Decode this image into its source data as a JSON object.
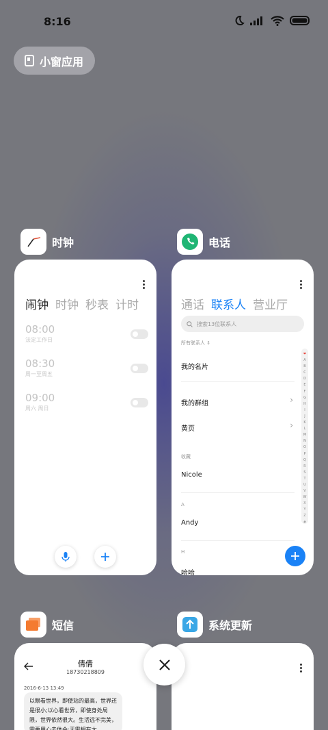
{
  "status": {
    "time": "8:16"
  },
  "float_window": {
    "label": "小窗应用"
  },
  "apps": {
    "clock": {
      "name": "时钟",
      "tabs": [
        "闹钟",
        "时钟",
        "秒表",
        "计时"
      ],
      "alarms": [
        {
          "time": "08:00",
          "sub": "法定工作日"
        },
        {
          "time": "08:30",
          "sub": "周一至周五"
        },
        {
          "time": "09:00",
          "sub": "周六 周日"
        }
      ]
    },
    "phone": {
      "name": "电话",
      "tabs": [
        "通话",
        "联系人",
        "营业厅"
      ],
      "search_placeholder": "搜索13位联系人",
      "all_contacts": "所有联系人",
      "my_card": "我的名片",
      "my_groups": "我的群组",
      "yellow_pages": "黄页",
      "favorites_label": "收藏",
      "section_a": "A",
      "section_h": "H",
      "contacts": [
        "Nicole",
        "Andy",
        "哈哈"
      ],
      "alphabet": [
        "❤",
        "A",
        "B",
        "C",
        "D",
        "E",
        "F",
        "G",
        "H",
        "I",
        "J",
        "K",
        "L",
        "M",
        "N",
        "O",
        "P",
        "Q",
        "R",
        "S",
        "T",
        "U",
        "V",
        "W",
        "X",
        "Y",
        "Z",
        "#"
      ]
    },
    "sms": {
      "name": "短信",
      "contact": "倩倩",
      "number": "18730218809",
      "date": "2016-6-13 13:49",
      "message": "以眼看世界，即使站的最高，世界还是很小;以心看世界，即使身处局限，世界依然很大。生活远不完美，需要用心去体会;无需相有太"
    },
    "update": {
      "name": "系统更新"
    }
  },
  "colors": {
    "accent": "#1a82f6",
    "phone_green": "#1fb574",
    "sms_orange": "#f47b30",
    "update_blue": "#3aa7e6"
  }
}
